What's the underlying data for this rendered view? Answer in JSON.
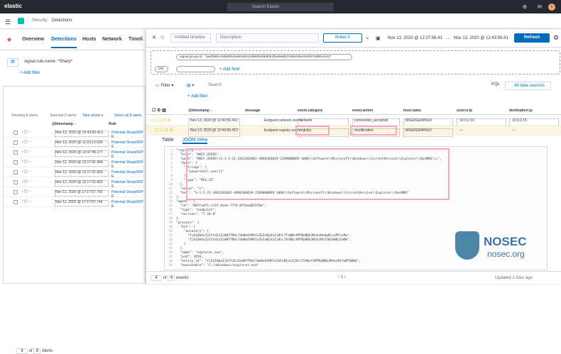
{
  "top": {
    "search": "Search Elastic",
    "brand": "elastic",
    "avatar": "s"
  },
  "crumbs": [
    "Security",
    "Detections"
  ],
  "nav": [
    "Overview",
    "Detections",
    "Hosts",
    "Network",
    "Timeli"
  ],
  "left": {
    "query": "signal.rule.name :*Sharp*",
    "add_filter": "+ Add filter",
    "showing": "Showing 8 alerts",
    "selected": "Selected 0 alerts",
    "take_action": "Take action ▾",
    "select_all": "Select all 8 alerts",
    "col_timestamp": "@timestamp ↓",
    "col_rule": "Rule",
    "rows": [
      [
        "Nov 13, 2020 @ 12:43:56.413",
        "Potential SharpRDP E"
      ],
      [
        "Nov 13, 2020 @ 11:23:13.629",
        "Potential SharpRDP E"
      ],
      [
        "Nov 12, 2020 @ 13:47:45.177",
        "Potential SharpRDP E"
      ],
      [
        "Nov 12, 2020 @ 12:17:01.834",
        "Potential SharpRDP E"
      ],
      [
        "Nov 12, 2020 @ 12:17:01.833",
        "Potential SharpRDP E"
      ],
      [
        "Nov 12, 2020 @ 12:17:01.832",
        "Potential SharpRDP E"
      ],
      [
        "Nov 11, 2020 @ 17:17:57.750",
        "Potential SharpRDP E"
      ],
      [
        "Nov 11, 2020 @ 17:17:57.749",
        "Potential SharpRDP E"
      ]
    ],
    "pager_count": "8",
    "pager_of": "of",
    "pager_total": "8",
    "pager_label": "Alerts"
  },
  "timeline": {
    "title_placeholder": "Untitled timeline",
    "desc_placeholder": "Description",
    "notes": "Notes",
    "notes_count": "0",
    "from": "Nov 13, 2020 @ 12:37:56.41",
    "arrow": "→",
    "to": "Nov 13, 2020 @ 12:43:56.41",
    "refresh": "Refresh",
    "pill": "signal.group.id : \"aa2f38bcc6685f5cbe6016912d890b4555bb1fbe9e8837dd6cb5e0180579d9fe4c53\"",
    "or": "OR",
    "add_field": "+ Add field",
    "filter": "Filter",
    "search_placeholder": "Search",
    "kql": "KQL",
    "all_sources": "All data sources",
    "headers": [
      "@timestamp ↓",
      "message",
      "event.category",
      "event.action",
      "host.name",
      "source.ip",
      "destination.ip"
    ],
    "rows": [
      [
        "Nov 13, 2020 @ 12:43:56.413",
        "Endpoint network event",
        "network",
        "connection_accepted",
        "MSEDGEWIN10",
        "10.0.2.16",
        "10.0.2.15"
      ],
      [
        "Nov 13, 2020 @ 12:43:56.413",
        "Endpoint registry event",
        "registry",
        "modification",
        "MSEDGEWIN10",
        "—",
        "—"
      ]
    ],
    "detail_tabs": [
      "Table",
      "JSON View"
    ],
    "json_lines": [
      "\"registry\": {",
      "  \"hive\": \"HKEY_USERS\",",
      "  \"path\": \"HKEY_USERS\\\\S-1-5-21-3461203602-4096304019-2269080069-1000\\\\Software\\\\Microsoft\\\\Windows\\\\CurrentVersion\\\\Explorer\\\\RunMRU\\\\c\",",
      "  \"data\": {",
      "    \"strings\": [",
      "      \"powershell.exe\\\\1\"",
      "    ],",
      "    \"type\": \"REG_SZ\"",
      "  },",
      "  \"value\": \"c\",",
      "  \"key\": \"S-1-5-21-3461203602-4096304019-2269080069-1000\\\\Software\\\\Microsoft\\\\Windows\\\\CurrentVersion\\\\Explorer\\\\RunMRU\"",
      "},",
      "\"agent\": {",
      "  \"id\": \"00ffedf1-c13f-4a4e-7f74-0f5dad655f8e\",",
      "  \"type\": \"endpoint\",",
      "  \"version\": \"7.10.0\"",
      "},",
      "\"process\": {",
      "  \"Ext\": {",
      "    \"ancestry\": [",
      "      \"YjA3ZmUxZjEtYzEzZi00YTRhLTdmNzQtMGYxZGIxNjUzZjBlLTYzNDktMTMyNDk3MzkzNzQwNjcxMTcxMw\",",
      "      \"YjA3ZmUxZjEtYzEzZi00YTRhLTdmNzQtMGYxZGIxNjUzZjBlLTUzNDctMTMyNDk3MzkzMzI5NzA0NjYwMA\",",
      "    ]",
      "  },",
      "  \"name\": \"explorer.exe\",",
      "  \"pid\": 2876,",
      "  \"entity_id\": \"YjA3ZmUxZjEtYzEzZi00YTRhLTdmNzQtMGYxZGIxNjUzZjBlLTI4NzYtMTMyNDk3MzkzMjYwMTQ0NA\",",
      "  \"executable\": \"C:\\\\Windows\\\\explorer.exe\""
    ],
    "line_numbers": [
      "2",
      "3",
      "4",
      "5",
      "6",
      "7",
      "8",
      "9",
      "10",
      "11",
      "12",
      "13",
      "14",
      "15",
      "16",
      "17",
      "18",
      "19",
      "20",
      "21",
      "22",
      "23",
      "24",
      "25",
      "26",
      "27",
      "28",
      "29"
    ],
    "pager_count": "4",
    "pager_of": "of",
    "pager_total": "4",
    "pager_label": "events",
    "page": "1",
    "updated": "Updated 1 hour ago"
  },
  "watermark": {
    "title": "NOSEC",
    "sub": "nosec.org"
  }
}
